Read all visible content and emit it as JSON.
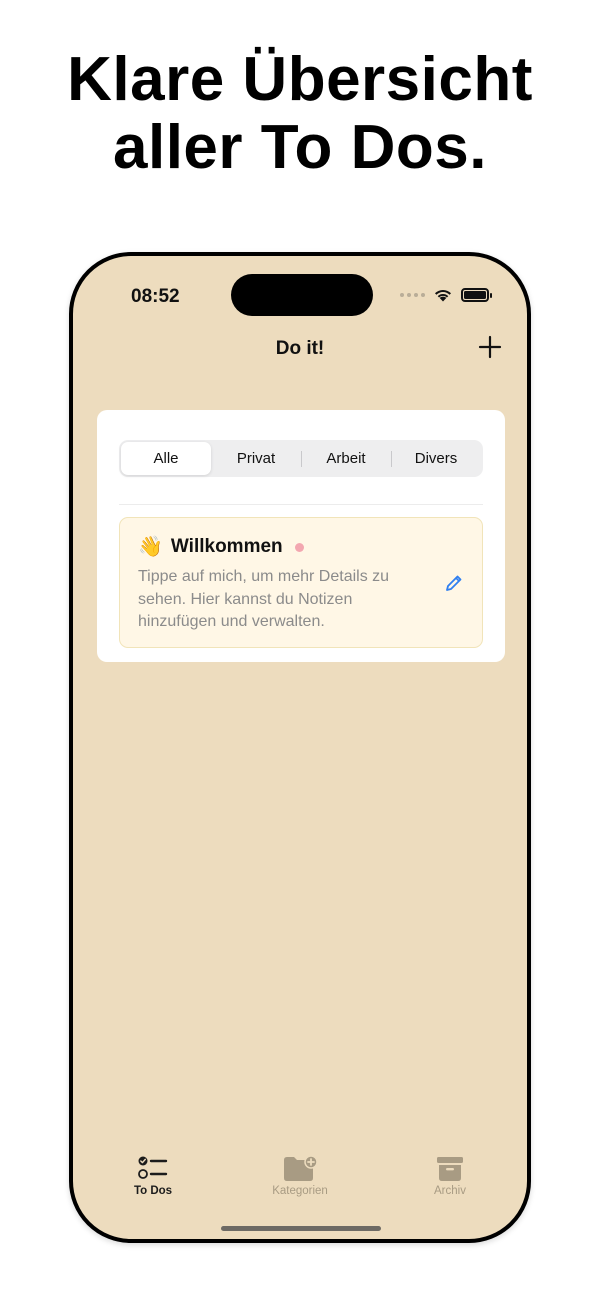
{
  "headline": {
    "line1": "Klare Übersicht",
    "line2": "aller To Dos."
  },
  "status_bar": {
    "time": "08:52",
    "icons": [
      "signal-dots-icon",
      "wifi-icon",
      "battery-icon"
    ]
  },
  "nav": {
    "title": "Do it!",
    "add_icon": "plus-icon"
  },
  "segments": {
    "items": [
      "Alle",
      "Privat",
      "Arbeit",
      "Divers"
    ],
    "selected": "Alle"
  },
  "todo": {
    "emoji": "👋",
    "title": "Willkommen",
    "body": "Tippe auf mich, um mehr Details zu sehen. Hier kannst du Notizen hinzufügen und verwalten.",
    "icons": [
      "waving-hand-icon",
      "pink-dot-icon",
      "pencil-icon"
    ]
  },
  "tabbar": {
    "items": [
      {
        "label": "To Dos",
        "icon": "checklist-icon",
        "active": true
      },
      {
        "label": "Kategorien",
        "icon": "folder-plus-icon",
        "active": false
      },
      {
        "label": "Archiv",
        "icon": "archive-box-icon",
        "active": false
      }
    ]
  },
  "colors": {
    "background": "#eddcbe",
    "card": "#ffffff",
    "todo_card": "#fff7e6",
    "accent_blue": "#2f7ff0",
    "tab_inactive": "#a89b83",
    "status_dot": "#f3a7b0"
  }
}
